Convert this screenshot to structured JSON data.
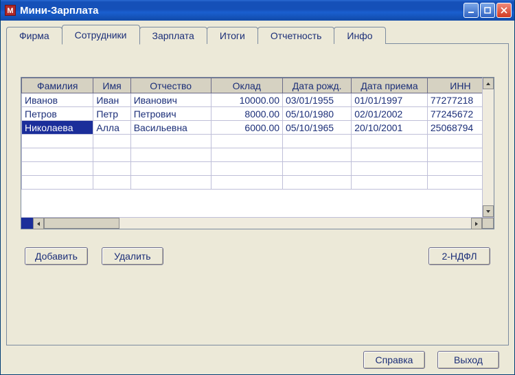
{
  "window": {
    "title": "Мини-Зарплата",
    "app_icon_letter": "M"
  },
  "tabs": [
    {
      "label": "Фирма",
      "active": false
    },
    {
      "label": "Сотрудники",
      "active": true
    },
    {
      "label": "Зарплата",
      "active": false
    },
    {
      "label": "Итоги",
      "active": false
    },
    {
      "label": "Отчетность",
      "active": false
    },
    {
      "label": "Инфо",
      "active": false
    }
  ],
  "grid": {
    "columns": [
      "Фамилия",
      "Имя",
      "Отчество",
      "Оклад",
      "Дата рожд.",
      "Дата приема",
      "ИНН"
    ],
    "rows": [
      {
        "cells": [
          "Иванов",
          "Иван",
          "Иванович",
          "10000.00",
          "03/01/1955",
          "01/01/1997",
          "77277218"
        ],
        "selected": false
      },
      {
        "cells": [
          "Петров",
          "Петр",
          "Петрович",
          "8000.00",
          "05/10/1980",
          "02/01/2002",
          "77245672"
        ],
        "selected": false
      },
      {
        "cells": [
          "Николаева",
          "Алла",
          "Васильевна",
          "6000.00",
          "05/10/1965",
          "20/10/2001",
          "25068794"
        ],
        "selected": true
      }
    ],
    "empty_rows": 4
  },
  "buttons": {
    "add": "Добавить",
    "delete": "Удалить",
    "ndfl2": "2-НДФЛ",
    "help": "Справка",
    "exit": "Выход"
  }
}
